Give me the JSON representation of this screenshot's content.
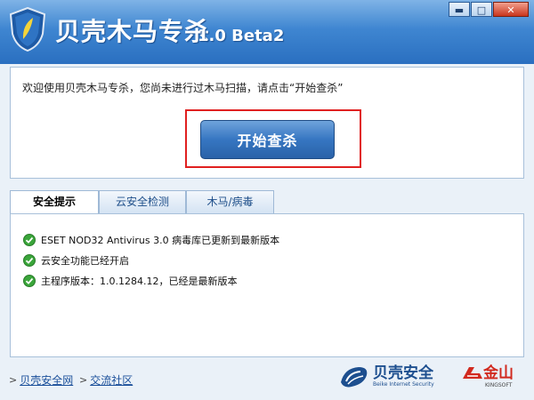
{
  "window": {
    "title": "贝壳木马专杀",
    "version": "1.0 Beta2",
    "buttons": {
      "minimize": "▬",
      "maximize": "□",
      "close": "✕"
    }
  },
  "welcome": {
    "message": "欢迎使用贝壳木马专杀，您尚未进行过木马扫描，请点击“开始查杀”",
    "start_button": "开始查杀"
  },
  "tabs": [
    {
      "label": "安全提示",
      "active": true
    },
    {
      "label": "云安全检测",
      "active": false
    },
    {
      "label": "木马/病毒",
      "active": false
    }
  ],
  "status_items": [
    {
      "text": "ESET NOD32 Antivirus 3.0 病毒库已更新到最新版本",
      "icon": "check-icon"
    },
    {
      "text": "云安全功能已经开启",
      "icon": "check-icon"
    },
    {
      "text": "主程序版本：1.0.1284.12，已经是最新版本",
      "icon": "check-icon"
    }
  ],
  "footer": {
    "links": [
      {
        "arrow": ">",
        "label": "贝壳安全网"
      },
      {
        "arrow": ">",
        "label": "交流社区"
      }
    ],
    "beike_logo": {
      "cn": "贝壳安全",
      "en": "Beike Internet Security"
    },
    "kingsoft_logo": {
      "cn": "金山",
      "en": "KINGSOFT"
    }
  },
  "colors": {
    "accent": "#2a6fc0",
    "highlight_border": "#e02020",
    "check_green": "#3aa53a"
  }
}
